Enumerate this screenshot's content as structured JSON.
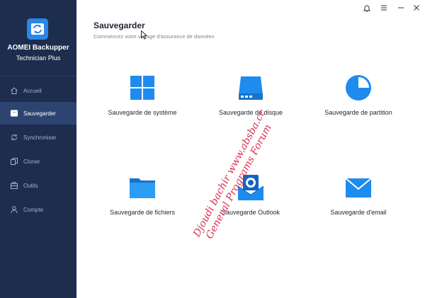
{
  "app": {
    "name": "AOMEI Backupper",
    "edition": "Technician Plus"
  },
  "sidebar": {
    "items": [
      {
        "label": "Accueil",
        "icon": "home-icon",
        "active": false
      },
      {
        "label": "Sauvegarder",
        "icon": "backup-icon",
        "active": true
      },
      {
        "label": "Synchroniser",
        "icon": "sync-icon",
        "active": false
      },
      {
        "label": "Cloner",
        "icon": "clone-icon",
        "active": false
      },
      {
        "label": "Outils",
        "icon": "tools-icon",
        "active": false
      },
      {
        "label": "Compte",
        "icon": "account-icon",
        "active": false
      }
    ]
  },
  "header": {
    "title": "Sauvegarder",
    "subtitle": "Commencez votre voyage d'assurance de données"
  },
  "tiles": [
    {
      "label": "Sauvegarde de système",
      "icon": "windows-icon"
    },
    {
      "label": "Sauvegarde de disque",
      "icon": "disk-icon"
    },
    {
      "label": "Sauvegarde de partition",
      "icon": "partition-pie-icon"
    },
    {
      "label": "Sauvegarde de fichiers",
      "icon": "folder-icon"
    },
    {
      "label": "Sauvegarde Outlook",
      "icon": "outlook-icon"
    },
    {
      "label": "Sauvegarde d'email",
      "icon": "email-icon"
    }
  ],
  "watermark": {
    "line1": "Djoudi bachir www.absba.cc",
    "line2": "General Programs Forum"
  },
  "colors": {
    "sidebar_bg": "#1c2d4e",
    "sidebar_active": "#2d4471",
    "accent": "#1e8bef",
    "watermark": "#d4183a"
  }
}
